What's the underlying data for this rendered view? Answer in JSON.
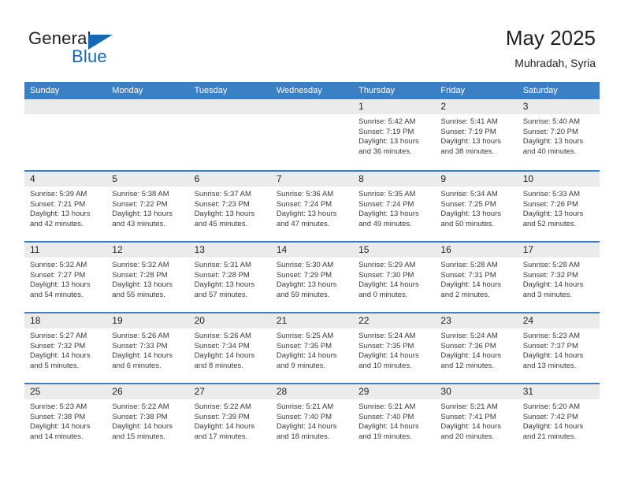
{
  "brand": {
    "name_part1": "General",
    "name_part2": "Blue",
    "accent_color": "#1668b3"
  },
  "header": {
    "title": "May 2025",
    "subtitle": "Muhradah, Syria"
  },
  "theme": {
    "header_row_color": "#3b7fc4",
    "date_strip_color": "#ebebeb",
    "text_color": "#231f20"
  },
  "weekday_headers": [
    "Sunday",
    "Monday",
    "Tuesday",
    "Wednesday",
    "Thursday",
    "Friday",
    "Saturday"
  ],
  "weeks": [
    [
      {
        "day": "",
        "lines": []
      },
      {
        "day": "",
        "lines": []
      },
      {
        "day": "",
        "lines": []
      },
      {
        "day": "",
        "lines": []
      },
      {
        "day": "1",
        "lines": [
          "Sunrise: 5:42 AM",
          "Sunset: 7:19 PM",
          "Daylight: 13 hours",
          "and 36 minutes."
        ]
      },
      {
        "day": "2",
        "lines": [
          "Sunrise: 5:41 AM",
          "Sunset: 7:19 PM",
          "Daylight: 13 hours",
          "and 38 minutes."
        ]
      },
      {
        "day": "3",
        "lines": [
          "Sunrise: 5:40 AM",
          "Sunset: 7:20 PM",
          "Daylight: 13 hours",
          "and 40 minutes."
        ]
      }
    ],
    [
      {
        "day": "4",
        "lines": [
          "Sunrise: 5:39 AM",
          "Sunset: 7:21 PM",
          "Daylight: 13 hours",
          "and 42 minutes."
        ]
      },
      {
        "day": "5",
        "lines": [
          "Sunrise: 5:38 AM",
          "Sunset: 7:22 PM",
          "Daylight: 13 hours",
          "and 43 minutes."
        ]
      },
      {
        "day": "6",
        "lines": [
          "Sunrise: 5:37 AM",
          "Sunset: 7:23 PM",
          "Daylight: 13 hours",
          "and 45 minutes."
        ]
      },
      {
        "day": "7",
        "lines": [
          "Sunrise: 5:36 AM",
          "Sunset: 7:24 PM",
          "Daylight: 13 hours",
          "and 47 minutes."
        ]
      },
      {
        "day": "8",
        "lines": [
          "Sunrise: 5:35 AM",
          "Sunset: 7:24 PM",
          "Daylight: 13 hours",
          "and 49 minutes."
        ]
      },
      {
        "day": "9",
        "lines": [
          "Sunrise: 5:34 AM",
          "Sunset: 7:25 PM",
          "Daylight: 13 hours",
          "and 50 minutes."
        ]
      },
      {
        "day": "10",
        "lines": [
          "Sunrise: 5:33 AM",
          "Sunset: 7:26 PM",
          "Daylight: 13 hours",
          "and 52 minutes."
        ]
      }
    ],
    [
      {
        "day": "11",
        "lines": [
          "Sunrise: 5:32 AM",
          "Sunset: 7:27 PM",
          "Daylight: 13 hours",
          "and 54 minutes."
        ]
      },
      {
        "day": "12",
        "lines": [
          "Sunrise: 5:32 AM",
          "Sunset: 7:28 PM",
          "Daylight: 13 hours",
          "and 55 minutes."
        ]
      },
      {
        "day": "13",
        "lines": [
          "Sunrise: 5:31 AM",
          "Sunset: 7:28 PM",
          "Daylight: 13 hours",
          "and 57 minutes."
        ]
      },
      {
        "day": "14",
        "lines": [
          "Sunrise: 5:30 AM",
          "Sunset: 7:29 PM",
          "Daylight: 13 hours",
          "and 59 minutes."
        ]
      },
      {
        "day": "15",
        "lines": [
          "Sunrise: 5:29 AM",
          "Sunset: 7:30 PM",
          "Daylight: 14 hours",
          "and 0 minutes."
        ]
      },
      {
        "day": "16",
        "lines": [
          "Sunrise: 5:28 AM",
          "Sunset: 7:31 PM",
          "Daylight: 14 hours",
          "and 2 minutes."
        ]
      },
      {
        "day": "17",
        "lines": [
          "Sunrise: 5:28 AM",
          "Sunset: 7:32 PM",
          "Daylight: 14 hours",
          "and 3 minutes."
        ]
      }
    ],
    [
      {
        "day": "18",
        "lines": [
          "Sunrise: 5:27 AM",
          "Sunset: 7:32 PM",
          "Daylight: 14 hours",
          "and 5 minutes."
        ]
      },
      {
        "day": "19",
        "lines": [
          "Sunrise: 5:26 AM",
          "Sunset: 7:33 PM",
          "Daylight: 14 hours",
          "and 6 minutes."
        ]
      },
      {
        "day": "20",
        "lines": [
          "Sunrise: 5:26 AM",
          "Sunset: 7:34 PM",
          "Daylight: 14 hours",
          "and 8 minutes."
        ]
      },
      {
        "day": "21",
        "lines": [
          "Sunrise: 5:25 AM",
          "Sunset: 7:35 PM",
          "Daylight: 14 hours",
          "and 9 minutes."
        ]
      },
      {
        "day": "22",
        "lines": [
          "Sunrise: 5:24 AM",
          "Sunset: 7:35 PM",
          "Daylight: 14 hours",
          "and 10 minutes."
        ]
      },
      {
        "day": "23",
        "lines": [
          "Sunrise: 5:24 AM",
          "Sunset: 7:36 PM",
          "Daylight: 14 hours",
          "and 12 minutes."
        ]
      },
      {
        "day": "24",
        "lines": [
          "Sunrise: 5:23 AM",
          "Sunset: 7:37 PM",
          "Daylight: 14 hours",
          "and 13 minutes."
        ]
      }
    ],
    [
      {
        "day": "25",
        "lines": [
          "Sunrise: 5:23 AM",
          "Sunset: 7:38 PM",
          "Daylight: 14 hours",
          "and 14 minutes."
        ]
      },
      {
        "day": "26",
        "lines": [
          "Sunrise: 5:22 AM",
          "Sunset: 7:38 PM",
          "Daylight: 14 hours",
          "and 15 minutes."
        ]
      },
      {
        "day": "27",
        "lines": [
          "Sunrise: 5:22 AM",
          "Sunset: 7:39 PM",
          "Daylight: 14 hours",
          "and 17 minutes."
        ]
      },
      {
        "day": "28",
        "lines": [
          "Sunrise: 5:21 AM",
          "Sunset: 7:40 PM",
          "Daylight: 14 hours",
          "and 18 minutes."
        ]
      },
      {
        "day": "29",
        "lines": [
          "Sunrise: 5:21 AM",
          "Sunset: 7:40 PM",
          "Daylight: 14 hours",
          "and 19 minutes."
        ]
      },
      {
        "day": "30",
        "lines": [
          "Sunrise: 5:21 AM",
          "Sunset: 7:41 PM",
          "Daylight: 14 hours",
          "and 20 minutes."
        ]
      },
      {
        "day": "31",
        "lines": [
          "Sunrise: 5:20 AM",
          "Sunset: 7:42 PM",
          "Daylight: 14 hours",
          "and 21 minutes."
        ]
      }
    ]
  ]
}
